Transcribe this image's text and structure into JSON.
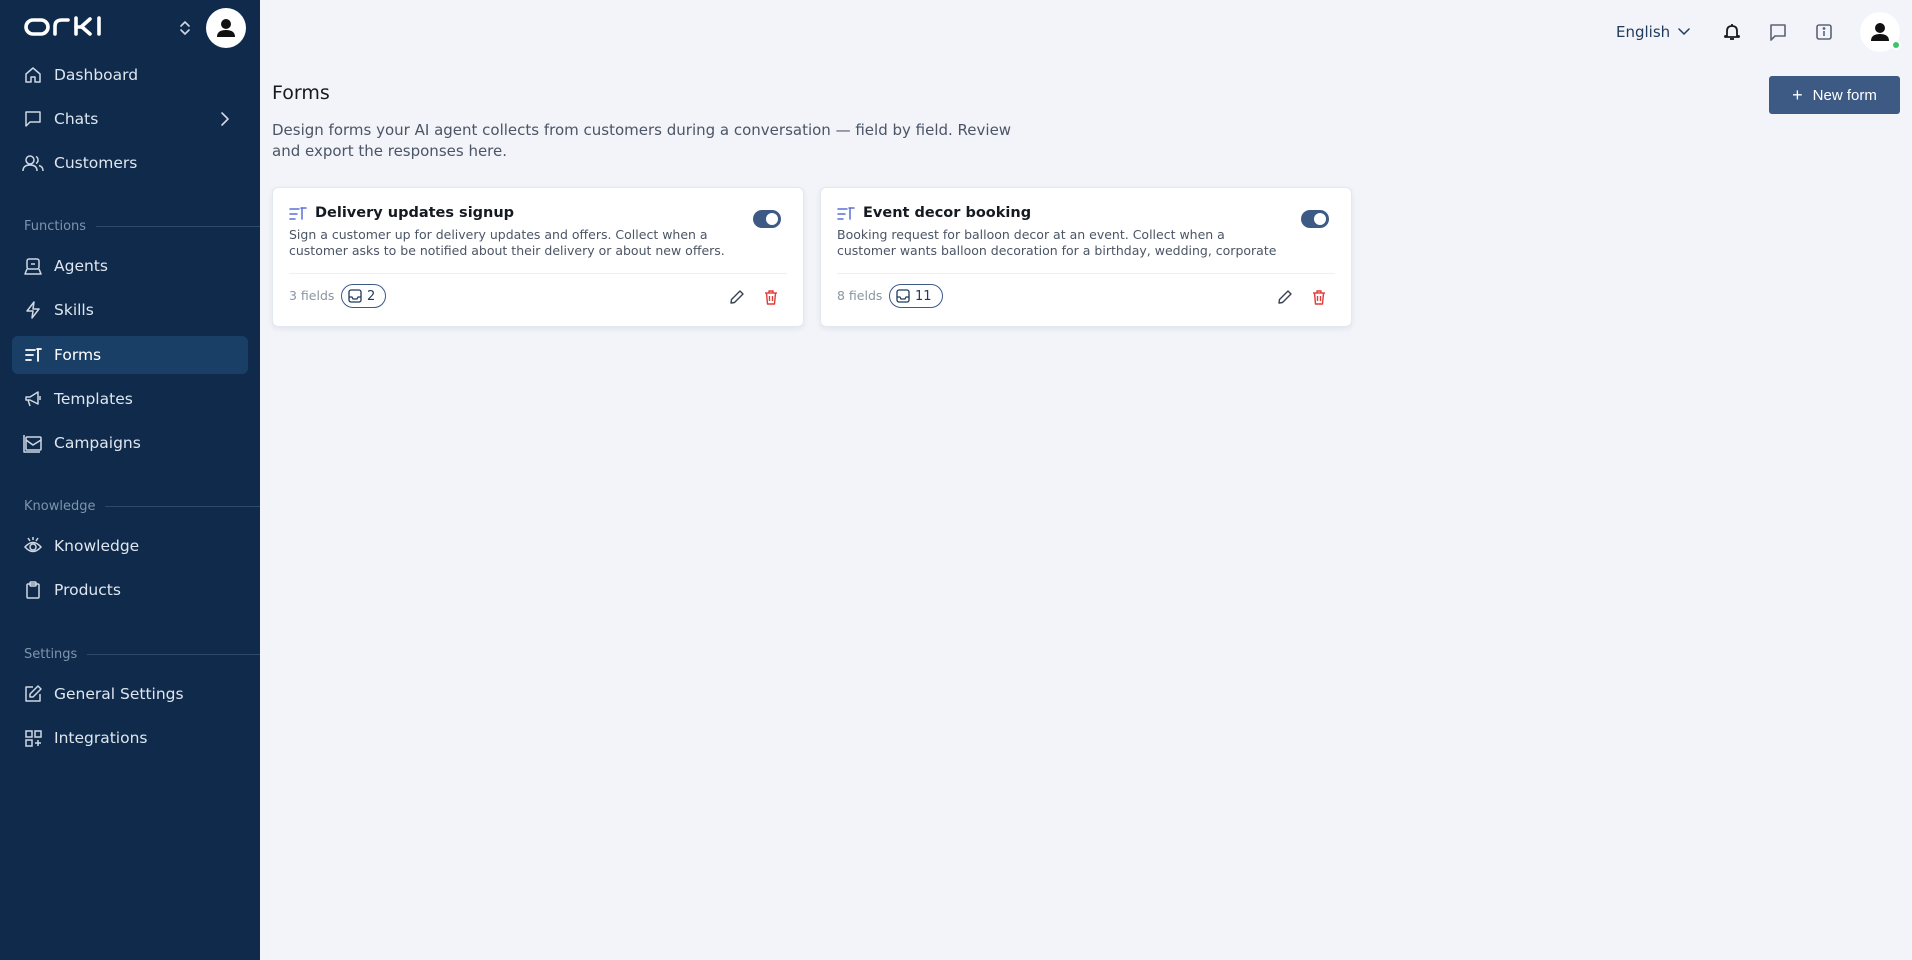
{
  "brand": {
    "logo_text": "ORKI"
  },
  "sidebar": {
    "items": [
      {
        "label": "Dashboard",
        "icon": "home-icon"
      },
      {
        "label": "Chats",
        "icon": "chat-icon"
      },
      {
        "label": "Customers",
        "icon": "users-icon"
      },
      {
        "label": "Agents",
        "icon": "agent-icon"
      },
      {
        "label": "Skills",
        "icon": "bolt-icon"
      },
      {
        "label": "Forms",
        "icon": "form-icon",
        "active": true
      },
      {
        "label": "Templates",
        "icon": "megaphone-icon"
      },
      {
        "label": "Campaigns",
        "icon": "campaign-icon"
      },
      {
        "label": "Knowledge",
        "icon": "knowledge-icon"
      },
      {
        "label": "Products",
        "icon": "clipboard-icon"
      },
      {
        "label": "General Settings",
        "icon": "edit-icon"
      },
      {
        "label": "Integrations",
        "icon": "grid-icon"
      }
    ],
    "sections": [
      "Functions",
      "Knowledge",
      "Settings"
    ]
  },
  "topbar": {
    "language": "English"
  },
  "main": {
    "title": "Forms",
    "description": "Design forms your AI agent collects from customers during a conversation — field by field. Review and export the responses here.",
    "new_button_label": "New form",
    "cards": [
      {
        "title": "Delivery updates signup",
        "description": "Sign a customer up for delivery updates and offers. Collect when a customer asks to be notified about their delivery or about new offers.",
        "fields": "3 fields",
        "responses": "2",
        "enabled": true
      },
      {
        "title": "Event decor booking",
        "description": "Booking request for balloon decor at an event. Collect when a customer wants balloon decoration for a birthday, wedding, corporate event, or...",
        "fields": "8 fields",
        "responses": "11",
        "enabled": true
      }
    ]
  },
  "colors": {
    "sidebar_bg": "#0f2a4a",
    "accent": "#3d5a85",
    "delete": "#e03b3b",
    "online": "#3cc46a"
  }
}
